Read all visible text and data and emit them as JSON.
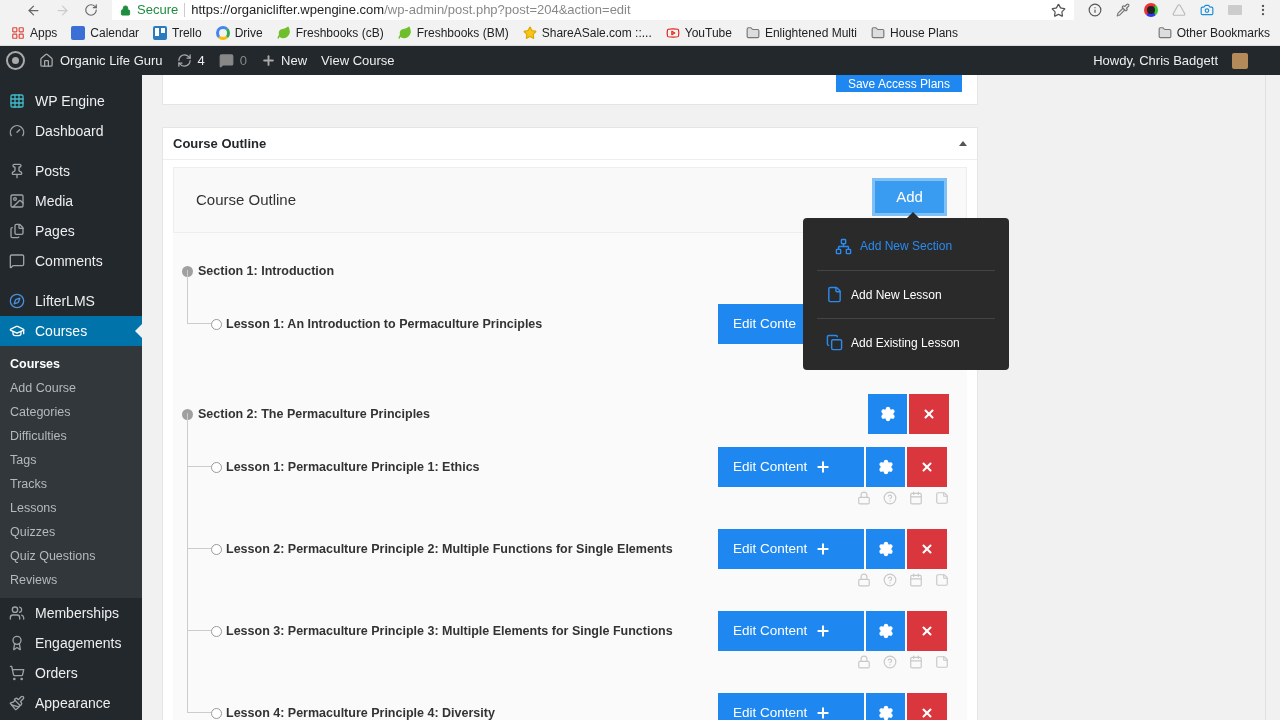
{
  "browser": {
    "secure_label": "Secure",
    "url_host": "https://organiclifter.wpengine.com",
    "url_path": "/wp-admin/post.php?post=204&action=edit"
  },
  "bookmarks": [
    {
      "label": "Apps",
      "kind": "apps"
    },
    {
      "label": "Calendar",
      "kind": "calendar"
    },
    {
      "label": "Trello",
      "kind": "trello"
    },
    {
      "label": "Drive",
      "kind": "google"
    },
    {
      "label": "Freshbooks (cB)",
      "kind": "leaf"
    },
    {
      "label": "Freshbooks (BM)",
      "kind": "leaf"
    },
    {
      "label": "ShareASale.com ::...",
      "kind": "star"
    },
    {
      "label": "YouTube",
      "kind": "youtube"
    },
    {
      "label": "Enlightened Multi",
      "kind": "folder"
    },
    {
      "label": "House Plans",
      "kind": "folder"
    }
  ],
  "other_bookmarks": "Other Bookmarks",
  "admin_bar": {
    "site": "Organic Life Guru",
    "updates": "4",
    "comments": "0",
    "new": "New",
    "view": "View Course",
    "howdy": "Howdy, Chris Badgett"
  },
  "sidebar": [
    {
      "items": [
        {
          "label": "WP Engine",
          "kind": "engine",
          "selected": false
        },
        {
          "label": "Dashboard",
          "kind": "dashboard",
          "selected": false
        }
      ]
    },
    {
      "items": [
        {
          "label": "Posts",
          "kind": "pin",
          "selected": false
        },
        {
          "label": "Media",
          "kind": "media",
          "selected": false
        },
        {
          "label": "Pages",
          "kind": "pages",
          "selected": false
        },
        {
          "label": "Comments",
          "kind": "comment",
          "selected": false
        }
      ]
    },
    {
      "items": [
        {
          "label": "LifterLMS",
          "kind": "lifter",
          "selected": false
        },
        {
          "label": "Courses",
          "kind": "courses",
          "selected": true,
          "children": [
            {
              "label": "Courses",
              "selected": true
            },
            {
              "label": "Add Course",
              "selected": false
            },
            {
              "label": "Categories",
              "selected": false
            },
            {
              "label": "Difficulties",
              "selected": false
            },
            {
              "label": "Tags",
              "selected": false
            },
            {
              "label": "Tracks",
              "selected": false
            },
            {
              "label": "Lessons",
              "selected": false
            },
            {
              "label": "Quizzes",
              "selected": false
            },
            {
              "label": "Quiz Questions",
              "selected": false
            },
            {
              "label": "Reviews",
              "selected": false
            }
          ]
        },
        {
          "label": "Memberships",
          "kind": "users",
          "selected": false
        },
        {
          "label": "Engagements",
          "kind": "award",
          "selected": false
        },
        {
          "label": "Orders",
          "kind": "cart",
          "selected": false
        },
        {
          "label": "Appearance",
          "kind": "brush",
          "selected": false
        }
      ]
    }
  ],
  "save_button": "Save Access Plans",
  "outline": {
    "panel_title": "Course Outline",
    "expanded": true,
    "box_title": "Course Outline",
    "add_button": "Add",
    "menu": [
      {
        "label": "Add New Section",
        "kind": "section",
        "selected": true
      },
      {
        "label": "Add New Lesson",
        "kind": "lesson",
        "selected": false
      },
      {
        "label": "Add Existing Lesson",
        "kind": "existing",
        "selected": false
      }
    ],
    "sections": [
      {
        "title": "Section 1: Introduction",
        "lessons": [
          {
            "title": "Lesson 1: An Introduction to Permaculture Principles",
            "actions": [
              {
                "kind": "edit",
                "label": "Edit Conte"
              }
            ],
            "status_icons": false
          }
        ]
      },
      {
        "title": "Section 2: The Permaculture Principles",
        "actions": [
          {
            "kind": "settings"
          },
          {
            "kind": "delete"
          }
        ],
        "lessons": [
          {
            "title": "Lesson 1: Permaculture Principle 1: Ethics",
            "actions": [
              {
                "kind": "edit",
                "label": "Edit Content",
                "plus": true
              },
              {
                "kind": "settings"
              },
              {
                "kind": "delete"
              }
            ],
            "status_icons": true
          },
          {
            "title": "Lesson 2: Permaculture Principle 2: Multiple Functions for Single Elements",
            "actions": [
              {
                "kind": "edit",
                "label": "Edit Content",
                "plus": true
              },
              {
                "kind": "settings"
              },
              {
                "kind": "delete"
              }
            ],
            "status_icons": true
          },
          {
            "title": "Lesson 3: Permaculture Principle 3: Multiple Elements for Single Functions",
            "actions": [
              {
                "kind": "edit",
                "label": "Edit Content",
                "plus": true
              },
              {
                "kind": "settings"
              },
              {
                "kind": "delete"
              }
            ],
            "status_icons": true
          },
          {
            "title": "Lesson 4: Permaculture Principle 4: Diversity",
            "actions": [
              {
                "kind": "edit",
                "label": "Edit Content",
                "plus": true
              },
              {
                "kind": "settings"
              },
              {
                "kind": "delete"
              }
            ],
            "status_icons": false
          }
        ]
      }
    ]
  }
}
